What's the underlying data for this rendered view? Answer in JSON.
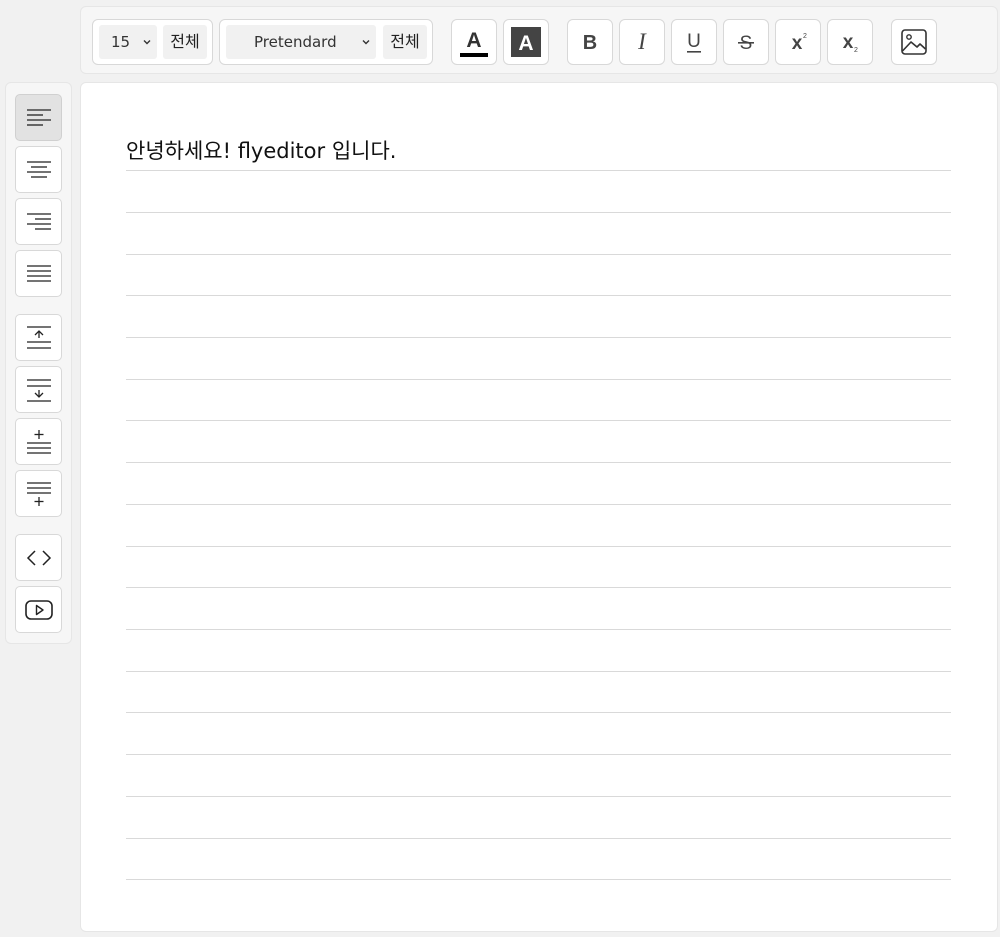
{
  "toolbar": {
    "font_size": {
      "value": "15",
      "apply_all_label": "전체"
    },
    "font_family": {
      "value": "Pretendard",
      "apply_all_label": "전체"
    },
    "buttons": {
      "text_color": "A",
      "bg_color": "A",
      "bold": "B",
      "italic": "I",
      "underline": "U",
      "strike": "S",
      "superscript_base": "x",
      "superscript_mark": "2",
      "subscript_base": "x",
      "subscript_mark": "2"
    },
    "icons": {
      "text_color": "text-color-icon",
      "bg_color": "background-color-icon",
      "image": "image-icon"
    }
  },
  "sidebar": {
    "items": [
      {
        "name": "align-left",
        "icon": "align-left-icon",
        "active": true
      },
      {
        "name": "align-center",
        "icon": "align-center-icon",
        "active": false
      },
      {
        "name": "align-right",
        "icon": "align-right-icon",
        "active": false
      },
      {
        "name": "align-justify",
        "icon": "align-justify-icon",
        "active": false
      },
      {
        "name": "move-line-up",
        "icon": "move-line-up-icon",
        "active": false
      },
      {
        "name": "move-line-down",
        "icon": "move-line-down-icon",
        "active": false
      },
      {
        "name": "insert-line-above",
        "icon": "insert-line-above-icon",
        "active": false
      },
      {
        "name": "insert-line-below",
        "icon": "insert-line-below-icon",
        "active": false
      },
      {
        "name": "code",
        "icon": "code-icon",
        "active": false
      },
      {
        "name": "youtube",
        "icon": "youtube-icon",
        "active": false
      }
    ]
  },
  "editor": {
    "content": "안녕하세요! flyeditor 입니다."
  },
  "colors": {
    "text_color_swatch": "#000000",
    "bg_color_swatch": "#444444",
    "active_item": "#e2e2e2"
  }
}
